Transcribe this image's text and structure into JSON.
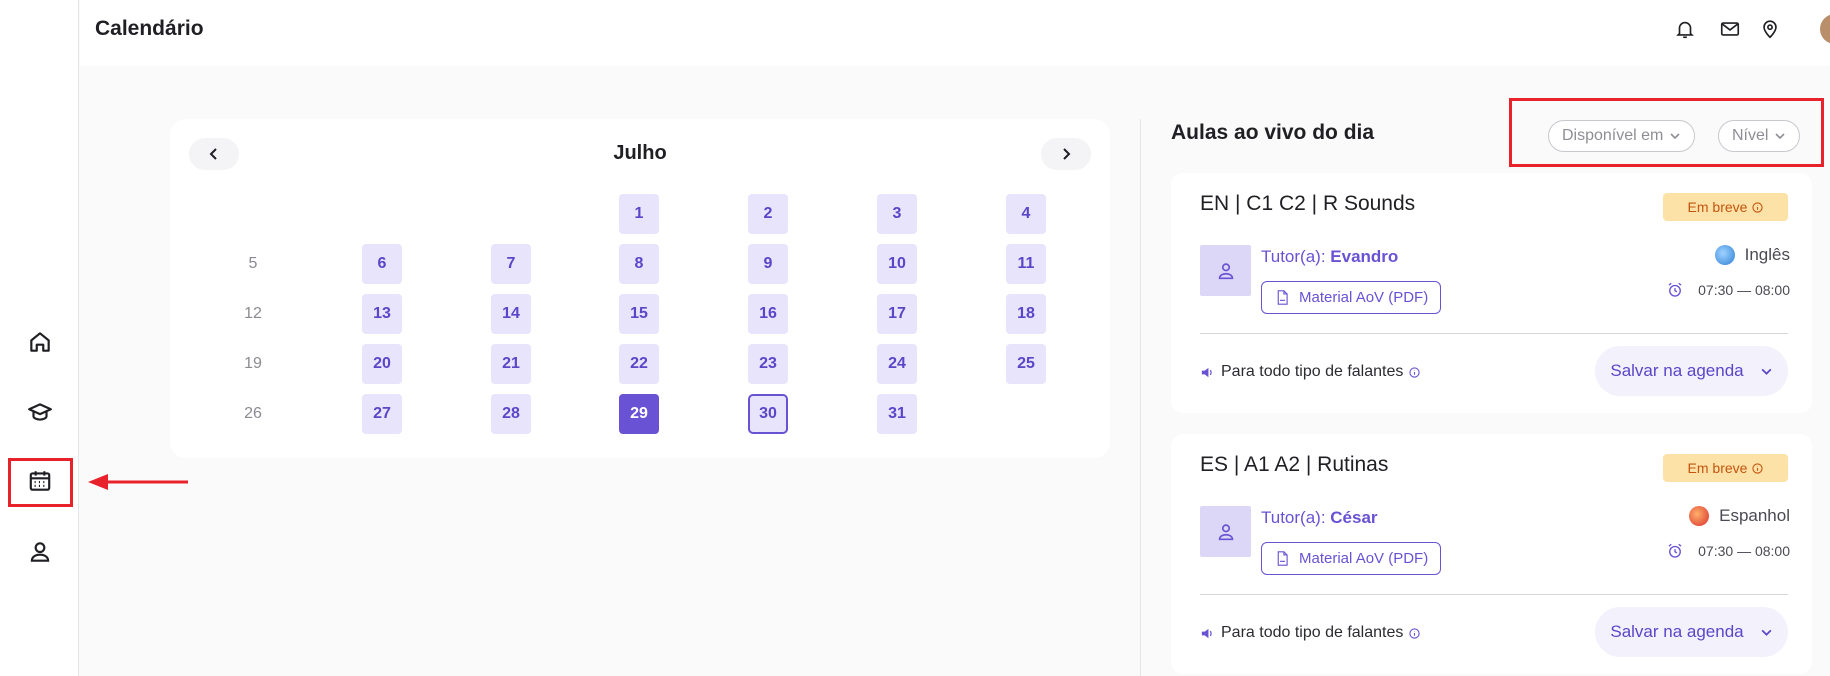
{
  "header": {
    "title": "Calendário"
  },
  "sidebar": {
    "items": [
      {
        "icon": "home-icon"
      },
      {
        "icon": "graduation-cap-icon"
      },
      {
        "icon": "calendar-icon",
        "active": true
      },
      {
        "icon": "user-icon"
      }
    ]
  },
  "calendar": {
    "month": "Julho",
    "days": [
      {
        "n": "1",
        "state": "active"
      },
      {
        "n": "2",
        "state": "active"
      },
      {
        "n": "3",
        "state": "active"
      },
      {
        "n": "4",
        "state": "active"
      },
      {
        "n": "5",
        "state": "inactive"
      },
      {
        "n": "6",
        "state": "active"
      },
      {
        "n": "7",
        "state": "active"
      },
      {
        "n": "8",
        "state": "active"
      },
      {
        "n": "9",
        "state": "active"
      },
      {
        "n": "10",
        "state": "active"
      },
      {
        "n": "11",
        "state": "active"
      },
      {
        "n": "12",
        "state": "inactive"
      },
      {
        "n": "13",
        "state": "active"
      },
      {
        "n": "14",
        "state": "active"
      },
      {
        "n": "15",
        "state": "active"
      },
      {
        "n": "16",
        "state": "active"
      },
      {
        "n": "17",
        "state": "active"
      },
      {
        "n": "18",
        "state": "active"
      },
      {
        "n": "19",
        "state": "inactive"
      },
      {
        "n": "20",
        "state": "active"
      },
      {
        "n": "21",
        "state": "active"
      },
      {
        "n": "22",
        "state": "active"
      },
      {
        "n": "23",
        "state": "active"
      },
      {
        "n": "24",
        "state": "active"
      },
      {
        "n": "25",
        "state": "active"
      },
      {
        "n": "26",
        "state": "inactive"
      },
      {
        "n": "27",
        "state": "active"
      },
      {
        "n": "28",
        "state": "active"
      },
      {
        "n": "29",
        "state": "selected"
      },
      {
        "n": "30",
        "state": "today"
      },
      {
        "n": "31",
        "state": "active"
      }
    ]
  },
  "live": {
    "title": "Aulas ao vivo do dia",
    "filters": {
      "available": "Disponível em",
      "level": "Nível"
    }
  },
  "lessons": [
    {
      "title": "EN | C1 C2 | R Sounds",
      "badge": "Em breve",
      "tutor_prefix": "Tutor(a): ",
      "tutor_name": "Evandro",
      "material": "Material AoV (PDF)",
      "language": "Inglês",
      "time": "07:30 — 08:00",
      "speakers": "Para todo tipo de falantes",
      "save": "Salvar na agenda"
    },
    {
      "title": "ES | A1 A2 | Rutinas",
      "badge": "Em breve",
      "tutor_prefix": "Tutor(a): ",
      "tutor_name": "César",
      "material": "Material AoV (PDF)",
      "language": "Espanhol",
      "time": "07:30 — 08:00",
      "speakers": "Para todo tipo de falantes",
      "save": "Salvar na agenda"
    }
  ],
  "colors": {
    "accent": "#6a52d4",
    "accent_light": "#e8e4fb",
    "badge_bg": "#fde2a8",
    "badge_text": "#c4540e",
    "annotation": "#e8222b"
  }
}
